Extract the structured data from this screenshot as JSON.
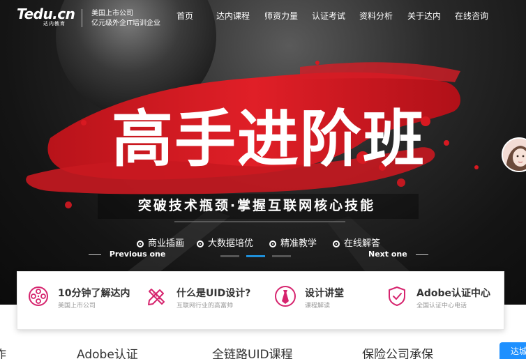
{
  "header": {
    "logo_text": "Tedu.cn",
    "logo_subtext": "达内教育",
    "slogan_line1": "美国上市公司",
    "slogan_line2": "亿元级外企IT培训企业",
    "nav": [
      {
        "label": "首页"
      },
      {
        "label": "达内课程"
      },
      {
        "label": "师资力量"
      },
      {
        "label": "认证考试"
      },
      {
        "label": "资料分析"
      },
      {
        "label": "关于达内"
      },
      {
        "label": "在线咨询"
      }
    ]
  },
  "banner": {
    "headline": "高手进阶班",
    "subtitle": "突破技术瓶颈·掌握互联网核心技能",
    "tags": [
      "商业插画",
      "大数据培优",
      "精准教学",
      "在线解答"
    ],
    "prev_label": "Previous one",
    "next_label": "Next one",
    "slide_count": 3,
    "active_slide": 2,
    "accent_color": "#d81921"
  },
  "features": [
    {
      "title": "10分钟了解达内",
      "subtitle": "美国上市公司",
      "icon": "film-reel-icon"
    },
    {
      "title": "什么是UID设计?",
      "subtitle": "互联网行业的高富帅",
      "icon": "pencil-ruler-icon"
    },
    {
      "title": "设计讲堂",
      "subtitle": "课程解读",
      "icon": "tie-icon"
    },
    {
      "title": "Adobe认证中心",
      "subtitle": "全国认证中心电话",
      "icon": "shield-check-icon"
    }
  ],
  "feature_icon_color": "#d6246e",
  "bottom_row": {
    "items": [
      "作",
      "Adobe认证",
      "全链路UID课程",
      "保险公司承保"
    ],
    "consult_label": "达城"
  }
}
